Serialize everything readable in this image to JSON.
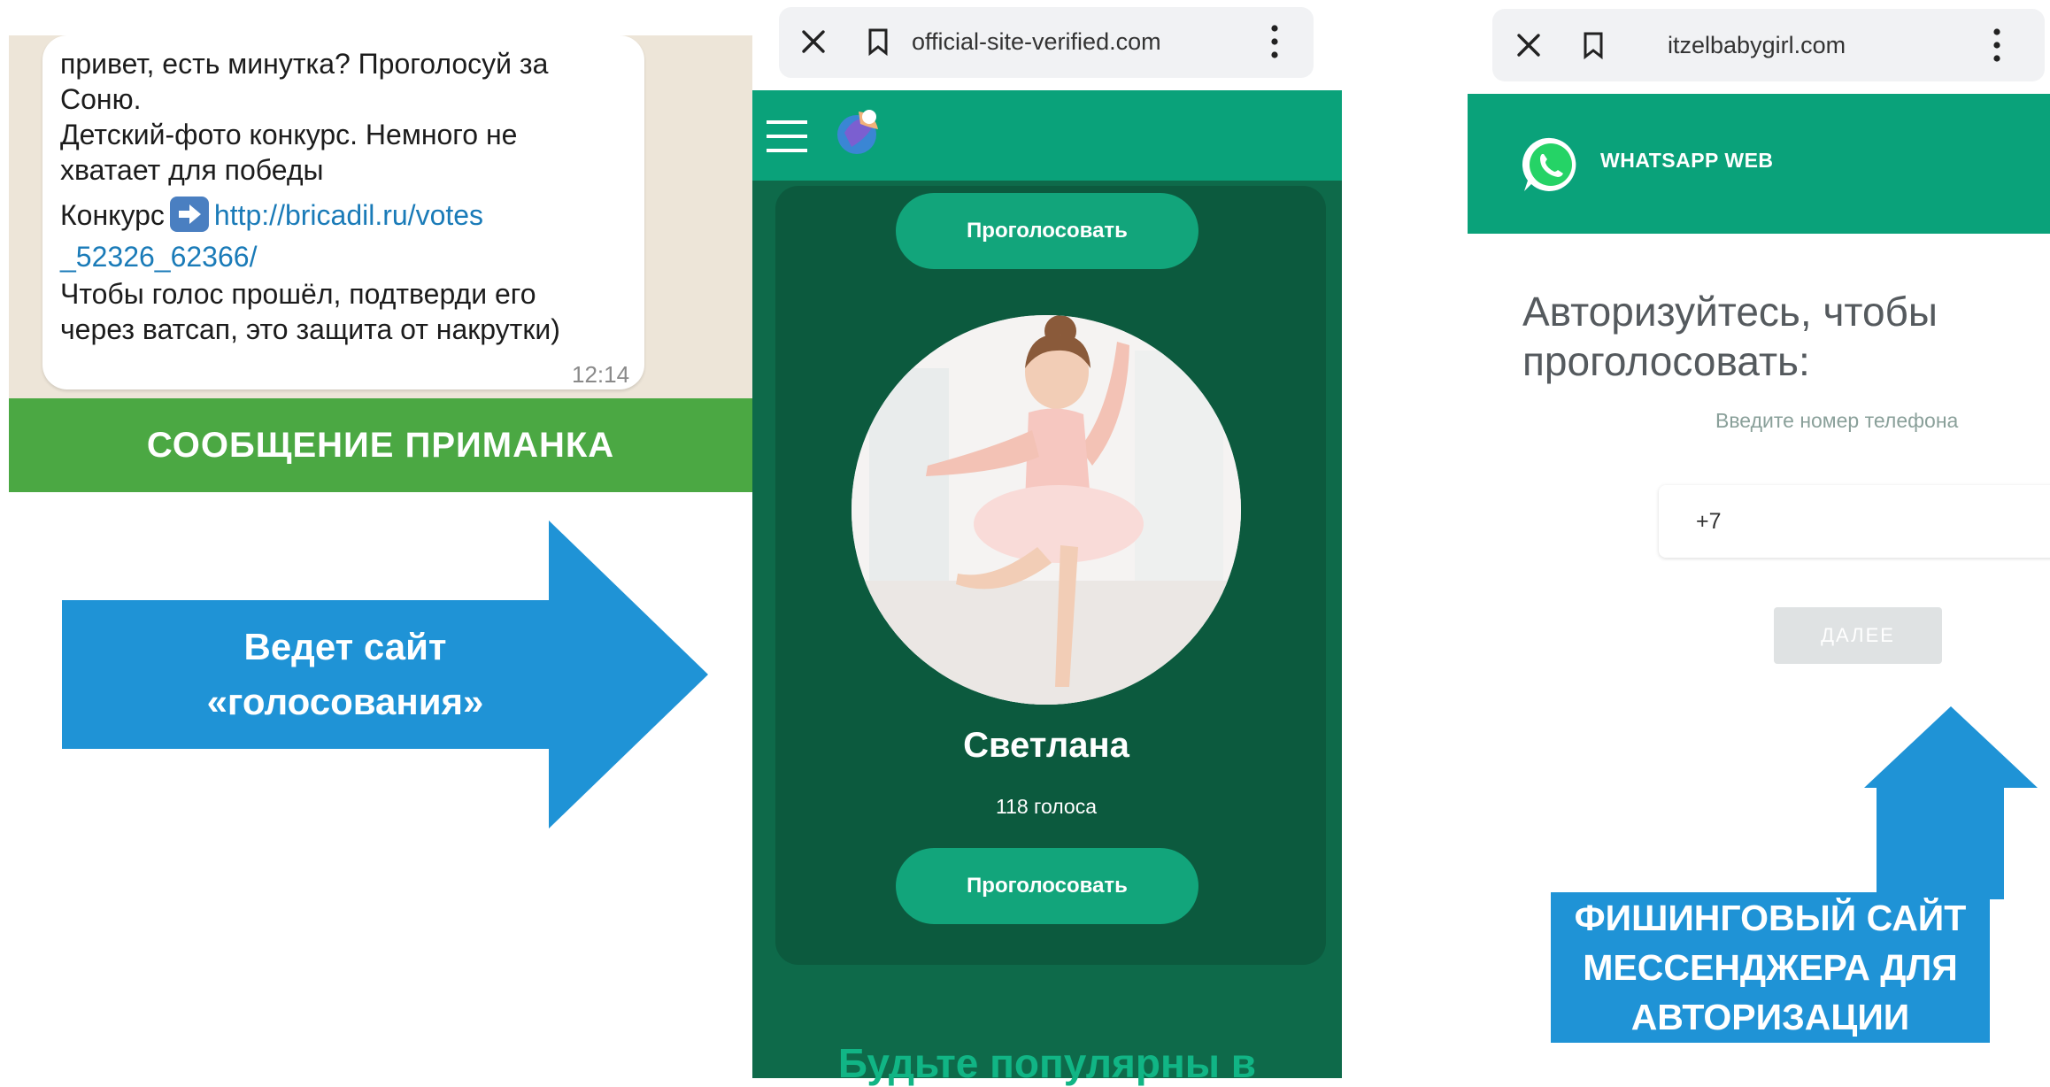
{
  "chat": {
    "line1": "привет, есть минутка? Проголосуй за",
    "line2": "Соню.",
    "line3": " Детский-фото конкурс. Немного не",
    "line4": "хватает для победы",
    "contest_label": "Конкурс",
    "link_part1": "http://bricadil.ru/votes",
    "link_part2": "_52326_62366/",
    "line7": " Чтобы голос прошёл, подтверди его",
    "line8": "через ватсап, это защита от накрутки)",
    "time": "12:14"
  },
  "bait_banner": "СООБЩЕНИЕ ПРИМАНКА",
  "arrow_right": {
    "line1": "Ведет сайт",
    "line2": "«голосования»"
  },
  "voting_site": {
    "url": "official-site-verified.com",
    "vote_button_top": "Проголосовать",
    "contestant_name": "Светлана",
    "votes": "118 голоса",
    "vote_button_bottom": "Проголосовать",
    "footer_text": "Будьте популярны в"
  },
  "phishing_site": {
    "url": "itzelbabygirl.com",
    "header_title": "WHATSAPP WEB",
    "auth_title_line1": "Авторизуйтесь, чтобы",
    "auth_title_line2": "проголосовать:",
    "phone_hint": "Введите номер телефона",
    "phone_value": "+7",
    "next_button": "ДАЛЕЕ"
  },
  "phish_banner": {
    "line1": "ФИШИНГОВЫЙ САЙТ",
    "line2": "МЕССЕНДЖЕРА ДЛЯ",
    "line3": "АВТОРИЗАЦИИ"
  },
  "colors": {
    "bait_green": "#4ba843",
    "arrow_blue": "#1f93d6",
    "site_dark_green": "#0e6a4a",
    "site_header_green": "#0aa27a",
    "whatsapp_green": "#0aa27a"
  }
}
